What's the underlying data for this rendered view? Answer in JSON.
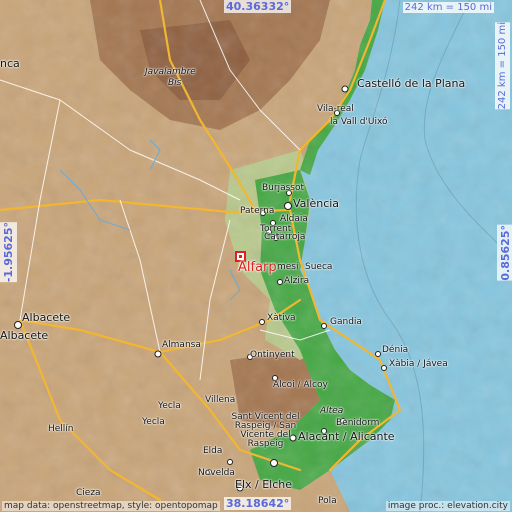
{
  "map": {
    "place": "Alfarp",
    "colors": {
      "sea": "#86c6df",
      "coastal_lowland": "#45a844",
      "plain": "#b7d690",
      "highland": "#c9a579",
      "mountain": "#9a6b45",
      "marker": "#e02020",
      "road_major": "#f2b630",
      "road_minor": "#ffffff",
      "coord_text": "#5a6ad8"
    },
    "labels": [
      {
        "text": "Castelló de la Plana"
      },
      {
        "text": "la Vall d'Uixó"
      },
      {
        "text": "Vila-real"
      },
      {
        "text": "Burjassot"
      },
      {
        "text": "València"
      },
      {
        "text": "Paterna"
      },
      {
        "text": "Aldaia"
      },
      {
        "text": "Torrent"
      },
      {
        "text": "Catarroja"
      },
      {
        "text": "Sueca"
      },
      {
        "text": "Alzira"
      },
      {
        "text": "Xàtiva"
      },
      {
        "text": "Gandia"
      },
      {
        "text": "Dénia"
      },
      {
        "text": "Xàbia / Jávea"
      },
      {
        "text": "Ontinyent"
      },
      {
        "text": "Alcoi / Alcoy"
      },
      {
        "text": "Almansa"
      },
      {
        "text": "Albacete"
      },
      {
        "text": "Albacete"
      },
      {
        "text": "Villena"
      },
      {
        "text": "Yecla"
      },
      {
        "text": "Yecla"
      },
      {
        "text": "Altea"
      },
      {
        "text": "Benidorm"
      },
      {
        "text": "Sant Vicent del Raspeig / San Vicente del Raspeig"
      },
      {
        "text": "Alacant / Alicante"
      },
      {
        "text": "Elda"
      },
      {
        "text": "Novelda"
      },
      {
        "text": "Elx / Elche"
      },
      {
        "text": "Hellín"
      },
      {
        "text": "Cieza"
      },
      {
        "text": "Javalambre"
      },
      {
        "text": "Bis"
      },
      {
        "text": "nca"
      },
      {
        "text": "mesí"
      },
      {
        "text": "Pola"
      }
    ],
    "coords": {
      "top": "40.36332°",
      "bottom": "38.18642°",
      "left": "-1.95625°",
      "right": "0.85625°"
    },
    "scale": {
      "horizontal": "242 km = 150 mi",
      "vertical": "242 km = 150 mi"
    },
    "credits": {
      "left": "map data: openstreetmap, style: opentopomap",
      "right": "image proc.: elevation.city"
    }
  }
}
